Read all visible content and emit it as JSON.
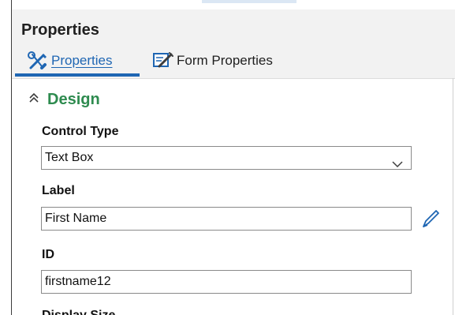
{
  "panel": {
    "title": "Properties"
  },
  "tabs": [
    {
      "label": "Properties",
      "icon": "tools-icon",
      "active": true
    },
    {
      "label": "Form Properties",
      "icon": "form-tools-icon",
      "active": false
    }
  ],
  "section": {
    "title": "Design",
    "icon": "double-chevron-up-icon"
  },
  "fields": {
    "control_type": {
      "label": "Control Type",
      "value": "Text Box"
    },
    "label": {
      "label": "Label",
      "value": "First Name",
      "edit_icon": "pencil-icon"
    },
    "id": {
      "label": "ID",
      "value": "firstname12"
    },
    "display_size": {
      "label": "Display Size"
    }
  },
  "colors": {
    "accent_blue": "#1f66b3",
    "section_green": "#2e8b4f",
    "header_bg": "#f2f2f2"
  }
}
